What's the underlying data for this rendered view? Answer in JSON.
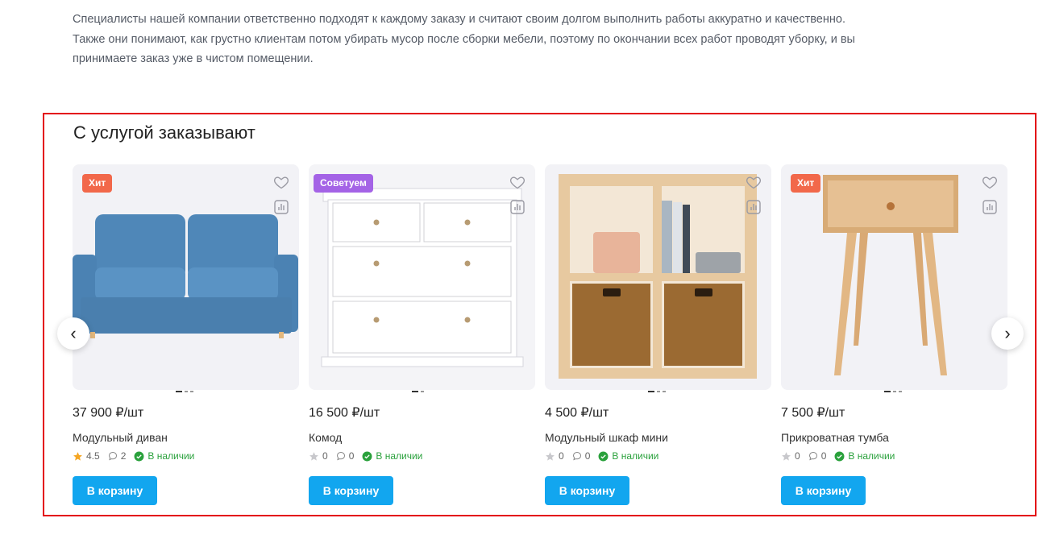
{
  "intro": {
    "lines": [
      "Специалисты нашей компании ответственно подходят к каждому заказу и считают своим долгом выполнить работы аккуратно и качественно.",
      "Также они понимают, как грустно клиентам потом убирать мусор после сборки мебели, поэтому по окончании всех работ проводят уборку, и вы",
      "принимаете заказ уже в чистом помещении."
    ]
  },
  "section": {
    "title": "С услугой заказывают",
    "prev_icon": "chevron-left-icon",
    "next_icon": "chevron-right-icon",
    "prev_label": "‹",
    "next_label": "›"
  },
  "products": [
    {
      "badge": "Хит",
      "price": "37 900 ₽/шт",
      "name": "Модульный диван",
      "rating": "4.5",
      "reviews": "2",
      "stock": "В наличии",
      "button": "В корзину",
      "rated": true
    },
    {
      "badge": "Советуем",
      "price": "16 500 ₽/шт",
      "name": "Комод",
      "rating": "0",
      "reviews": "0",
      "stock": "В наличии",
      "button": "В корзину",
      "rated": false
    },
    {
      "badge": "",
      "price": "4 500 ₽/шт",
      "name": "Модульный шкаф мини",
      "rating": "0",
      "reviews": "0",
      "stock": "В наличии",
      "button": "В корзину",
      "rated": false
    },
    {
      "badge": "Хит",
      "price": "7 500 ₽/шт",
      "name": "Прикроватная тумба",
      "rating": "0",
      "reviews": "0",
      "stock": "В наличии",
      "button": "В корзину",
      "rated": false
    }
  ],
  "colors": {
    "accent": "#12a6ef",
    "highlight_border": "#e30613",
    "badge_hit": "#f2684a",
    "badge_advice": "#a463e6",
    "in_stock": "#2aa13c",
    "star_active": "#f5a623"
  }
}
